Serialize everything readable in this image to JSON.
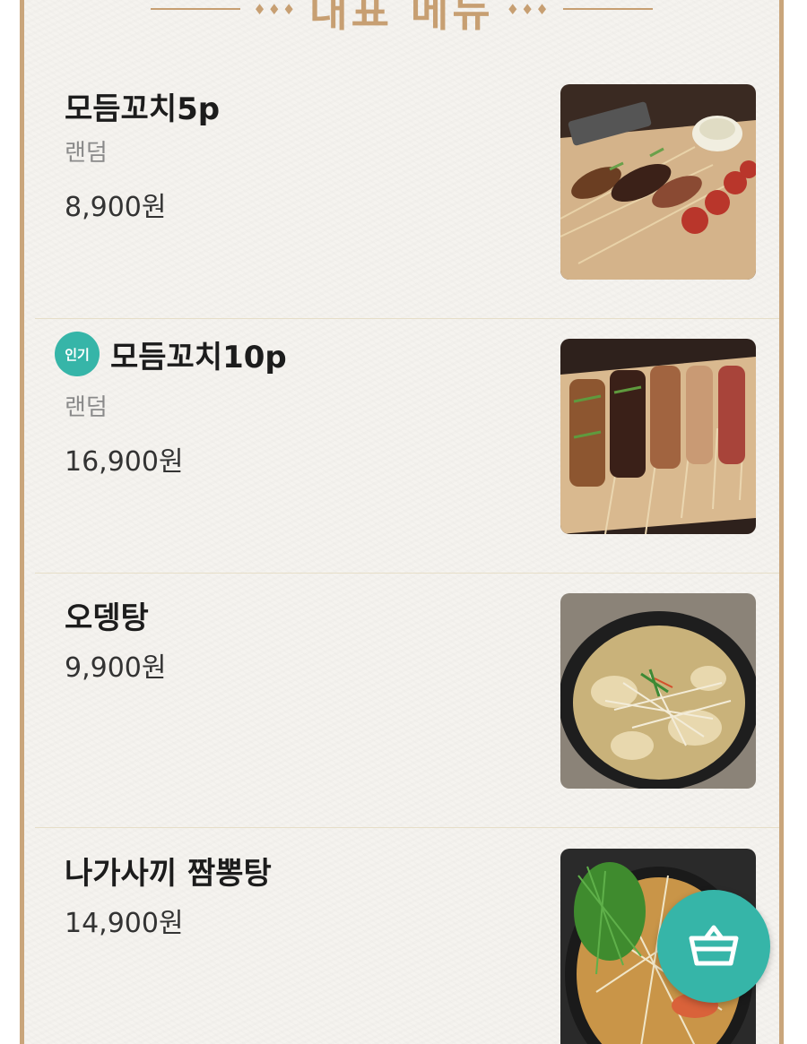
{
  "section": {
    "title": "대표 메뉴",
    "ornament": "♦♦♦"
  },
  "items": [
    {
      "name": "모듬꼬치5p",
      "sub": "랜덤",
      "price": "8,900원",
      "image": "skewer-platter-photo"
    },
    {
      "name": "모듬꼬치10p",
      "badge": "인기",
      "sub": "랜덤",
      "price": "16,900원",
      "image": "skewer-platter-large-photo"
    },
    {
      "name": "오뎅탕",
      "price": "9,900원",
      "image": "fishcake-soup-photo"
    },
    {
      "name": "나가사끼 짬뽕탕",
      "price": "14,900원",
      "image": "nagasaki-jjamppong-photo"
    }
  ],
  "cart_button": {
    "icon": "basket-icon"
  },
  "colors": {
    "accent": "#c79f72",
    "badge": "#36b5a8",
    "fab": "#36b5a8"
  }
}
